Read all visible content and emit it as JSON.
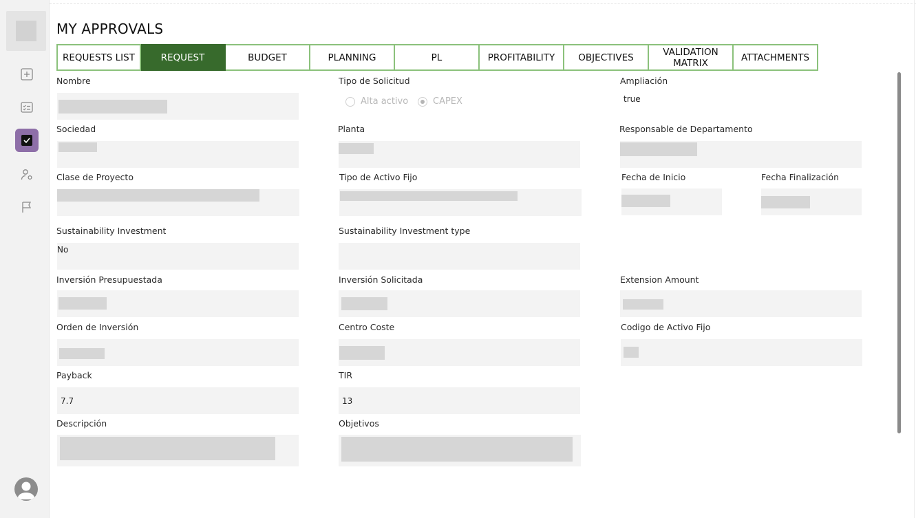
{
  "app": {
    "title": "MY APPROVALS"
  },
  "sidebar": {
    "items": [
      {
        "icon": "plus-square-icon"
      },
      {
        "icon": "checklist-icon"
      },
      {
        "icon": "checkbox-icon",
        "active": true
      },
      {
        "icon": "user-settings-icon"
      },
      {
        "icon": "flag-icon"
      }
    ],
    "accent_color": "#8e6fa8"
  },
  "tabs": [
    {
      "label": "REQUESTS LIST"
    },
    {
      "label": "REQUEST",
      "active": true
    },
    {
      "label": "BUDGET"
    },
    {
      "label": "PLANNING"
    },
    {
      "label": "PL"
    },
    {
      "label": "PROFITABILITY"
    },
    {
      "label": "OBJECTIVES"
    },
    {
      "label": "VALIDATION MATRIX"
    },
    {
      "label": "ATTACHMENTS"
    }
  ],
  "tab_colors": {
    "active_bg": "#376a2c",
    "border": "#8bc17b"
  },
  "form": {
    "nombre_label": "Nombre",
    "tipo_solicitud_label": "Tipo de Solicitud",
    "tipo_solicitud_options": [
      "Alta activo",
      "CAPEX"
    ],
    "tipo_solicitud_selected": "CAPEX",
    "ampliacion_label": "Ampliación",
    "ampliacion_value": "true",
    "sociedad_label": "Sociedad",
    "planta_label": "Planta",
    "responsable_label": "Responsable de Departamento",
    "clase_proyecto_label": "Clase de Proyecto",
    "tipo_activo_label": "Tipo de Activo Fijo",
    "fecha_inicio_label": "Fecha de Inicio",
    "fecha_fin_label": "Fecha Finalización",
    "sust_inv_label": "Sustainability Investment",
    "sust_inv_value": "No",
    "sust_inv_type_label": "Sustainability Investment type",
    "inv_presupuestada_label": "Inversión Presupuestada",
    "inv_solicitada_label": "Inversión Solicitada",
    "extension_amount_label": "Extension Amount",
    "orden_inversion_label": "Orden de Inversión",
    "centro_coste_label": "Centro Coste",
    "codigo_activo_label": "Codigo de Activo Fijo",
    "payback_label": "Payback",
    "payback_value": "7.7",
    "tir_label": "TIR",
    "tir_value": "13",
    "descripcion_label": "Descripción",
    "objetivos_label": "Objetivos"
  }
}
